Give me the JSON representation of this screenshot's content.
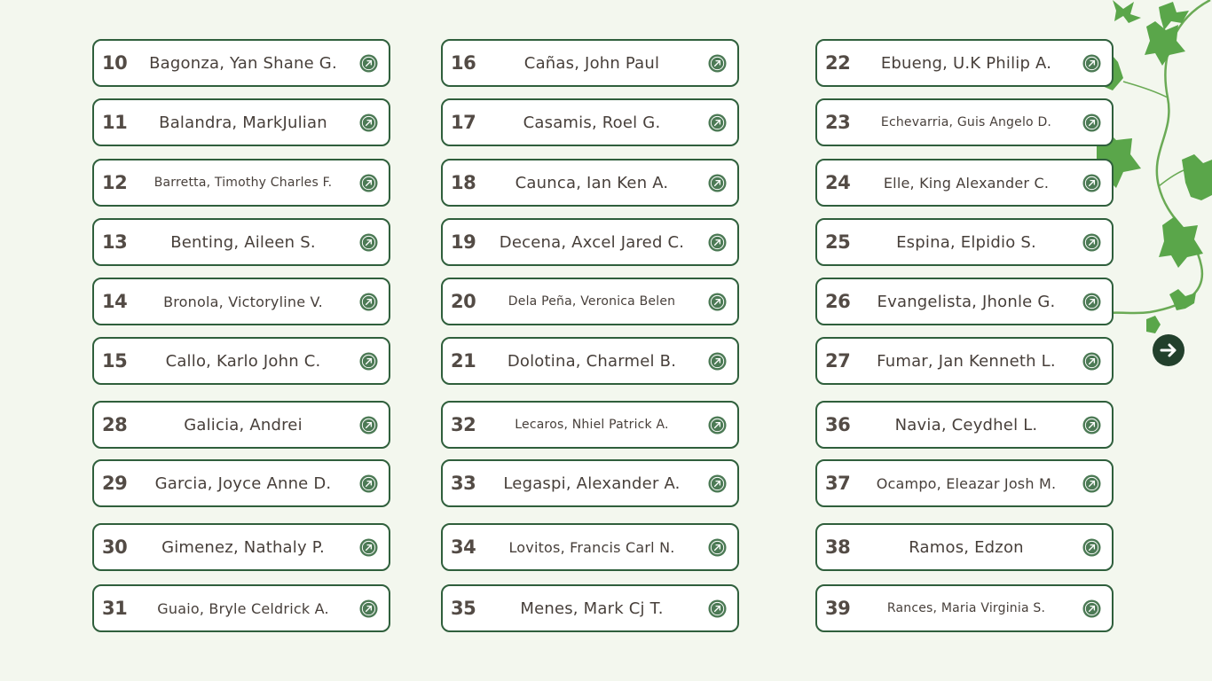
{
  "students": [
    {
      "num": "10",
      "name": "Bagonza, Yan Shane G."
    },
    {
      "num": "11",
      "name": "Balandra, MarkJulian"
    },
    {
      "num": "12",
      "name": "Barretta, Timothy Charles F."
    },
    {
      "num": "13",
      "name": "Benting, Aileen S."
    },
    {
      "num": "14",
      "name": "Bronola, Victoryline V."
    },
    {
      "num": "15",
      "name": "Callo, Karlo John C."
    },
    {
      "num": "16",
      "name": "Cañas, John Paul"
    },
    {
      "num": "17",
      "name": "Casamis, Roel G."
    },
    {
      "num": "18",
      "name": "Caunca, Ian Ken A."
    },
    {
      "num": "19",
      "name": "Decena, Axcel Jared C."
    },
    {
      "num": "20",
      "name": "Dela Peña, Veronica Belen"
    },
    {
      "num": "21",
      "name": "Dolotina, Charmel B."
    },
    {
      "num": "22",
      "name": "Ebueng, U.K Philip A."
    },
    {
      "num": "23",
      "name": "Echevarria, Guis Angelo D."
    },
    {
      "num": "24",
      "name": "Elle, King Alexander C."
    },
    {
      "num": "25",
      "name": "Espina, Elpidio S."
    },
    {
      "num": "26",
      "name": "Evangelista, Jhonle G."
    },
    {
      "num": "27",
      "name": "Fumar, Jan Kenneth L."
    },
    {
      "num": "28",
      "name": "Galicia, Andrei"
    },
    {
      "num": "29",
      "name": "Garcia, Joyce Anne D."
    },
    {
      "num": "30",
      "name": "Gimenez, Nathaly P."
    },
    {
      "num": "31",
      "name": "Guaio, Bryle Celdrick A."
    },
    {
      "num": "32",
      "name": "Lecaros, Nhiel Patrick A."
    },
    {
      "num": "33",
      "name": "Legaspi, Alexander A."
    },
    {
      "num": "34",
      "name": "Lovitos, Francis Carl N."
    },
    {
      "num": "35",
      "name": "Menes, Mark Cj T."
    },
    {
      "num": "36",
      "name": "Navia, Ceydhel L."
    },
    {
      "num": "37",
      "name": "Ocampo, Eleazar Josh M."
    },
    {
      "num": "38",
      "name": "Ramos, Edzon"
    },
    {
      "num": "39",
      "name": "Rances, Maria Virginia S."
    }
  ],
  "icons": {
    "card_link": "arrow-up-right-circle-icon",
    "next": "arrow-right-circle-icon",
    "decoration": "ivy-vine-icon"
  },
  "colors": {
    "background": "#f3f7ee",
    "card_border": "#2f5f3c",
    "link_icon": "#4c7a55",
    "next_button": "#22402c",
    "leaf": "#5aa64a"
  }
}
